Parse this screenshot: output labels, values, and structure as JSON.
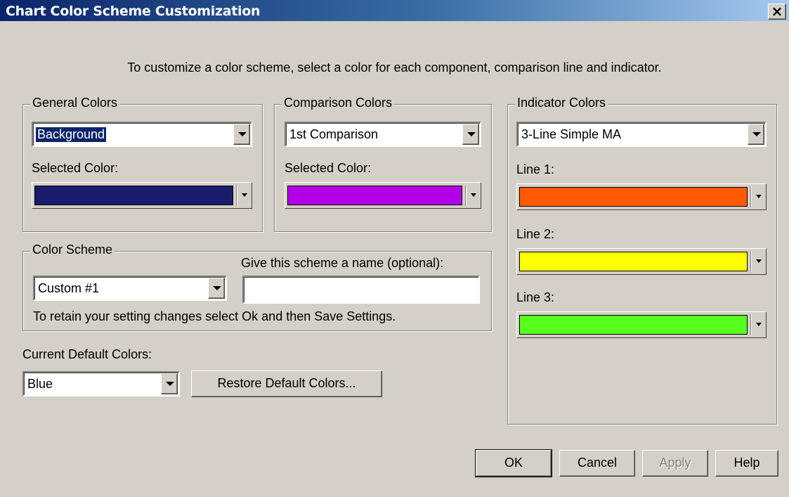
{
  "window": {
    "title": "Chart Color Scheme Customization",
    "close_label": "×"
  },
  "intro": "To customize a color scheme, select a color for each component, comparison line and indicator.",
  "general": {
    "legend": "General Colors",
    "selected": "Background",
    "color_label": "Selected Color:",
    "color": "#1c1c6e"
  },
  "comparison": {
    "legend": "Comparison Colors",
    "selected": "1st Comparison",
    "color_label": "Selected Color:",
    "color": "#b400e6"
  },
  "indicator": {
    "legend": "Indicator Colors",
    "selected": "3-Line Simple MA",
    "lines": [
      {
        "label": "Line 1:",
        "color": "#ff5a00"
      },
      {
        "label": "Line 2:",
        "color": "#ffff00"
      },
      {
        "label": "Line 3:",
        "color": "#56ff1e"
      }
    ]
  },
  "scheme": {
    "legend": "Color Scheme",
    "selected": "Custom #1",
    "name_label": "Give this scheme a name (optional):",
    "name_value": "",
    "note": "To retain your setting changes select Ok and then Save Settings."
  },
  "defaults": {
    "label": "Current Default Colors:",
    "selected": "Blue",
    "restore_label": "Restore Default Colors..."
  },
  "buttons": {
    "ok": "OK",
    "cancel": "Cancel",
    "apply": "Apply",
    "help": "Help"
  }
}
